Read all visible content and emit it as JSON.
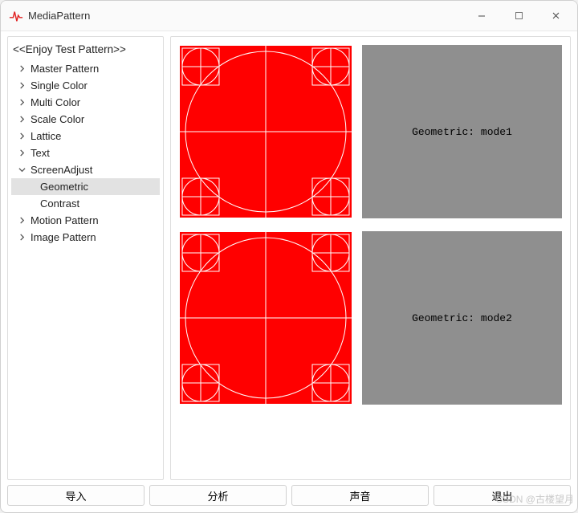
{
  "window": {
    "title": "MediaPattern",
    "controls": {
      "minimize": "Minimize",
      "maximize": "Maximize",
      "close": "Close"
    }
  },
  "sidebar": {
    "header": "<<Enjoy Test Pattern>>",
    "items": [
      {
        "label": "Master Pattern",
        "expanded": false
      },
      {
        "label": "Single Color",
        "expanded": false
      },
      {
        "label": "Multi Color",
        "expanded": false
      },
      {
        "label": "Scale Color",
        "expanded": false
      },
      {
        "label": "Lattice",
        "expanded": false
      },
      {
        "label": "Text",
        "expanded": false
      },
      {
        "label": "ScreenAdjust",
        "expanded": true,
        "children": [
          {
            "label": "Geometric",
            "selected": true
          },
          {
            "label": "Contrast",
            "selected": false
          }
        ]
      },
      {
        "label": "Motion Pattern",
        "expanded": false
      },
      {
        "label": "Image Pattern",
        "expanded": false
      }
    ]
  },
  "content": {
    "rows": [
      {
        "caption": "Geometric: mode1"
      },
      {
        "caption": "Geometric: mode2"
      }
    ]
  },
  "footer": {
    "buttons": [
      {
        "label": "导入"
      },
      {
        "label": "分析"
      },
      {
        "label": "声音"
      },
      {
        "label": "退出"
      }
    ]
  },
  "watermark": "CSDN @古楼望月",
  "colors": {
    "thumb_bg": "#ff0000",
    "desc_bg": "#8f8f8f"
  }
}
